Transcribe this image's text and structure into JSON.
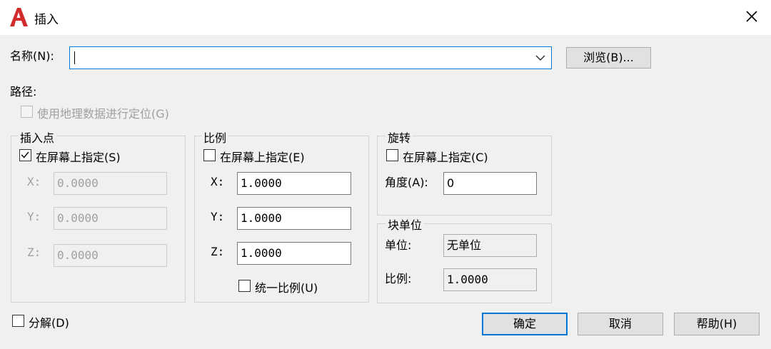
{
  "window": {
    "title": "插入",
    "close_glyph": "✕"
  },
  "name_row": {
    "label": "名称(N):",
    "value": "",
    "browse_label": "浏览(B)..."
  },
  "path_label": "路径:",
  "geo_checkbox": {
    "label": "使用地理数据进行定位(G)",
    "checked": false,
    "enabled": false
  },
  "insert_point": {
    "legend": "插入点",
    "specify": {
      "label": "在屏幕上指定(S)",
      "checked": true
    },
    "x_label": "X:",
    "x_value": "0.0000",
    "y_label": "Y:",
    "y_value": "0.0000",
    "z_label": "Z:",
    "z_value": "0.0000"
  },
  "scale": {
    "legend": "比例",
    "specify": {
      "label": "在屏幕上指定(E)",
      "checked": false
    },
    "x_label": "X:",
    "x_value": "1.0000",
    "y_label": "Y:",
    "y_value": "1.0000",
    "z_label": "Z:",
    "z_value": "1.0000",
    "uniform": {
      "label": "统一比例(U)",
      "checked": false
    }
  },
  "rotation": {
    "legend": "旋转",
    "specify": {
      "label": "在屏幕上指定(C)",
      "checked": false
    },
    "angle_label": "角度(A):",
    "angle_value": "0"
  },
  "block_unit": {
    "legend": "块单位",
    "unit_label": "单位:",
    "unit_value": "无单位",
    "factor_label": "比例:",
    "factor_value": "1.0000"
  },
  "explode": {
    "label": "分解(D)",
    "checked": false
  },
  "buttons": {
    "ok": "确定",
    "cancel": "取消",
    "help": "帮助(H)"
  },
  "colors": {
    "accent": "#0078d7",
    "app_icon": "#d22b2b"
  }
}
